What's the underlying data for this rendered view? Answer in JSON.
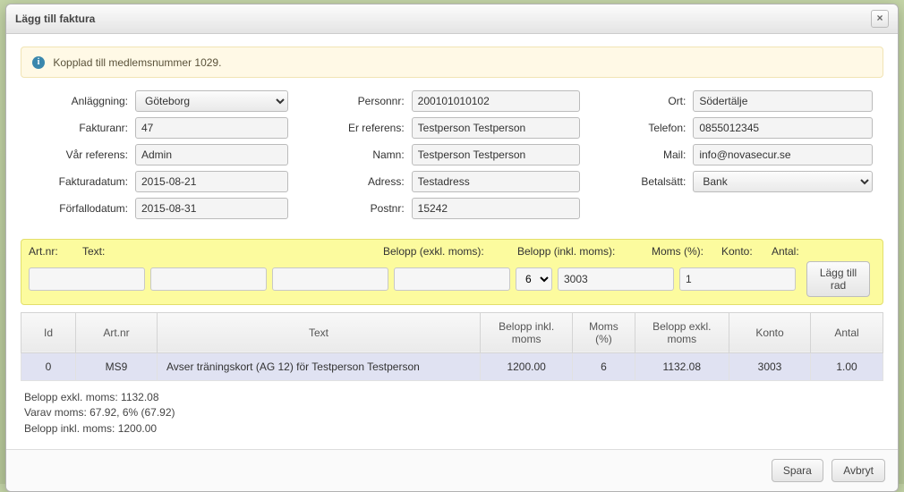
{
  "dialog": {
    "title": "Lägg till faktura",
    "close_label": "×"
  },
  "info": {
    "message": "Kopplad till medlemsnummer 1029."
  },
  "form": {
    "labels": {
      "anlaggning": "Anläggning:",
      "fakturanr": "Fakturanr:",
      "var_ref": "Vår referens:",
      "fakturadatum": "Fakturadatum:",
      "forfallodatum": "Förfallodatum:",
      "personnr": "Personnr:",
      "er_ref": "Er referens:",
      "namn": "Namn:",
      "adress": "Adress:",
      "postnr": "Postnr:",
      "ort": "Ort:",
      "telefon": "Telefon:",
      "mail": "Mail:",
      "betalsatt": "Betalsätt:"
    },
    "values": {
      "anlaggning": "Göteborg",
      "fakturanr": "47",
      "var_ref": "Admin",
      "fakturadatum": "2015-08-21",
      "forfallodatum": "2015-08-31",
      "personnr": "200101010102",
      "er_ref": "Testperson Testperson",
      "namn": "Testperson Testperson",
      "adress": "Testadress",
      "postnr": "15242",
      "ort": "Södertälje",
      "telefon": "0855012345",
      "mail": "info@novasecur.se",
      "betalsatt": "Bank"
    }
  },
  "addrow": {
    "labels": {
      "artnr": "Art.nr:",
      "text": "Text:",
      "belopp_exkl": "Belopp (exkl. moms):",
      "belopp_inkl": "Belopp (inkl. moms):",
      "moms": "Moms (%):",
      "konto": "Konto:",
      "antal": "Antal:"
    },
    "values": {
      "artnr": "",
      "text": "",
      "belopp_exkl": "",
      "belopp_inkl": "",
      "moms": "6",
      "konto": "3003",
      "antal": "1"
    },
    "button_label": "Lägg till rad"
  },
  "table": {
    "headers": {
      "id": "Id",
      "artnr": "Art.nr",
      "text": "Text",
      "belopp_inkl": "Belopp inkl. moms",
      "moms": "Moms (%)",
      "belopp_exkl": "Belopp exkl. moms",
      "konto": "Konto",
      "antal": "Antal"
    },
    "rows": [
      {
        "id": "0",
        "artnr": "MS9",
        "text": "Avser träningskort (AG 12) för Testperson Testperson",
        "belopp_inkl": "1200.00",
        "moms": "6",
        "belopp_exkl": "1132.08",
        "konto": "3003",
        "antal": "1.00"
      }
    ]
  },
  "summary": {
    "line1": "Belopp exkl. moms: 1132.08",
    "line2": "Varav moms: 67.92, 6% (67.92)",
    "line3": "Belopp inkl. moms: 1200.00"
  },
  "buttons": {
    "save": "Spara",
    "cancel": "Avbryt"
  }
}
